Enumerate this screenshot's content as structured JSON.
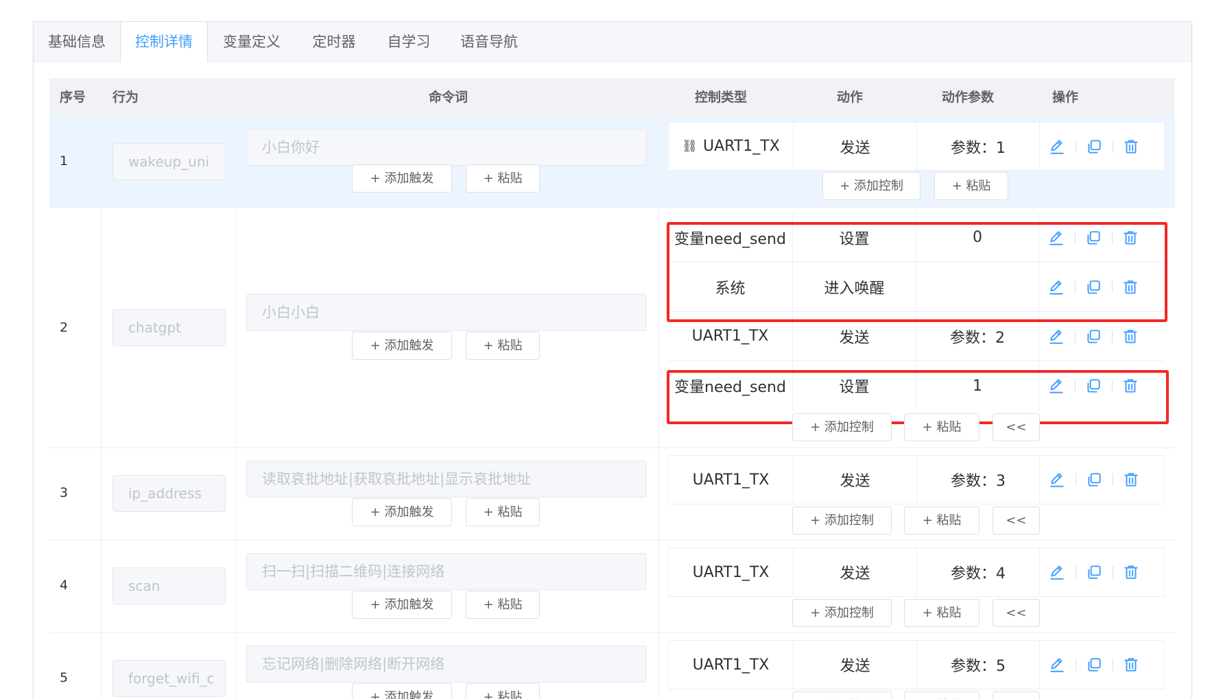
{
  "tabs": [
    "基础信息",
    "控制详情",
    "变量定义",
    "定时器",
    "自学习",
    "语音导航"
  ],
  "headers": {
    "idx": "序号",
    "behavior": "行为",
    "command": "命令词",
    "ctype": "控制类型",
    "action": "动作",
    "param": "动作参数",
    "ops": "操作"
  },
  "buttons": {
    "add_trigger": "+ 添加触发",
    "paste": "+ 粘贴",
    "add_control": "+ 添加控制",
    "collapse": "<<"
  },
  "rows": [
    {
      "idx": "1",
      "behavior": "wakeup_uni",
      "command": "小白你好",
      "controls": [
        {
          "ctype": "UART1_TX",
          "ctype_icon": "serial-port-icon",
          "action": "发送",
          "param": "参数：1"
        }
      ]
    },
    {
      "idx": "2",
      "behavior": "chatgpt",
      "command": "小白小白",
      "controls": [
        {
          "ctype": "变量need_send",
          "action": "设置",
          "param": "0"
        },
        {
          "ctype": "系统",
          "action": "进入唤醒",
          "param": ""
        },
        {
          "ctype": "UART1_TX",
          "action": "发送",
          "param": "参数：2"
        },
        {
          "ctype": "变量need_send",
          "action": "设置",
          "param": "1"
        }
      ]
    },
    {
      "idx": "3",
      "behavior": "ip_address",
      "command": "读取哀批地址|获取哀批地址|显示哀批地址",
      "controls": [
        {
          "ctype": "UART1_TX",
          "action": "发送",
          "param": "参数：3"
        }
      ]
    },
    {
      "idx": "4",
      "behavior": "scan",
      "command": "扫一扫|扫描二维码|连接网络",
      "controls": [
        {
          "ctype": "UART1_TX",
          "action": "发送",
          "param": "参数：4"
        }
      ]
    },
    {
      "idx": "5",
      "behavior": "forget_wifi_c",
      "command": "忘记网络|删除网络|断开网络",
      "controls": [
        {
          "ctype": "UART1_TX",
          "action": "发送",
          "param": "参数：5"
        }
      ]
    }
  ],
  "colors": {
    "accent": "#409eff",
    "highlight_row": "#ecf5ff",
    "annotation": "#f42727"
  }
}
